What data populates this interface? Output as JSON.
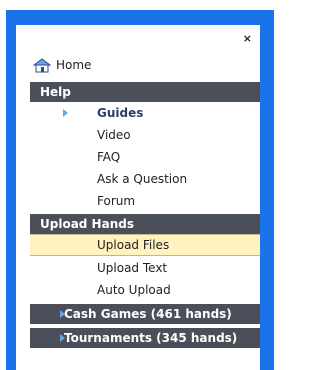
{
  "close": {
    "icon": "close-icon",
    "glyph": "×"
  },
  "home": {
    "label": "Home",
    "icon": "home-icon"
  },
  "help": {
    "title": "Help",
    "items": [
      {
        "label": "Guides"
      },
      {
        "label": "Video"
      },
      {
        "label": "FAQ"
      },
      {
        "label": "Ask a Question"
      },
      {
        "label": "Forum"
      }
    ]
  },
  "upload": {
    "title": "Upload Hands",
    "items": [
      {
        "label": "Upload Files"
      },
      {
        "label": "Upload Text"
      },
      {
        "label": "Auto Upload"
      }
    ]
  },
  "collapsed_sections": [
    {
      "label": "Cash Games (461 hands)"
    },
    {
      "label": "Tournaments (345 hands)"
    }
  ],
  "colors": {
    "frame_blue": "#1a73e8",
    "header_bg": "#4a4f59",
    "selected_bg": "#fff2bf",
    "arrow_blue": "#6aa6e6"
  }
}
